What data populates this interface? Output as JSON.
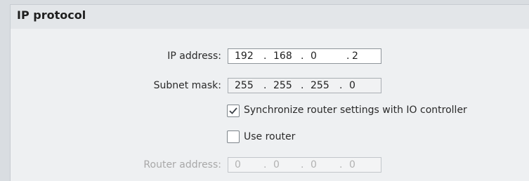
{
  "section": {
    "title": "IP protocol"
  },
  "ip_address": {
    "label": "IP address:",
    "octets": [
      "192",
      "168",
      "0",
      "2"
    ]
  },
  "subnet_mask": {
    "label": "Subnet mask:",
    "octets": [
      "255",
      "255",
      "255",
      "0"
    ]
  },
  "sync_router": {
    "label": "Synchronize router settings with IO controller",
    "checked": true
  },
  "use_router": {
    "label": "Use router",
    "checked": false
  },
  "router_address": {
    "label": "Router address:",
    "octets": [
      "0",
      "0",
      "0",
      "0"
    ]
  }
}
